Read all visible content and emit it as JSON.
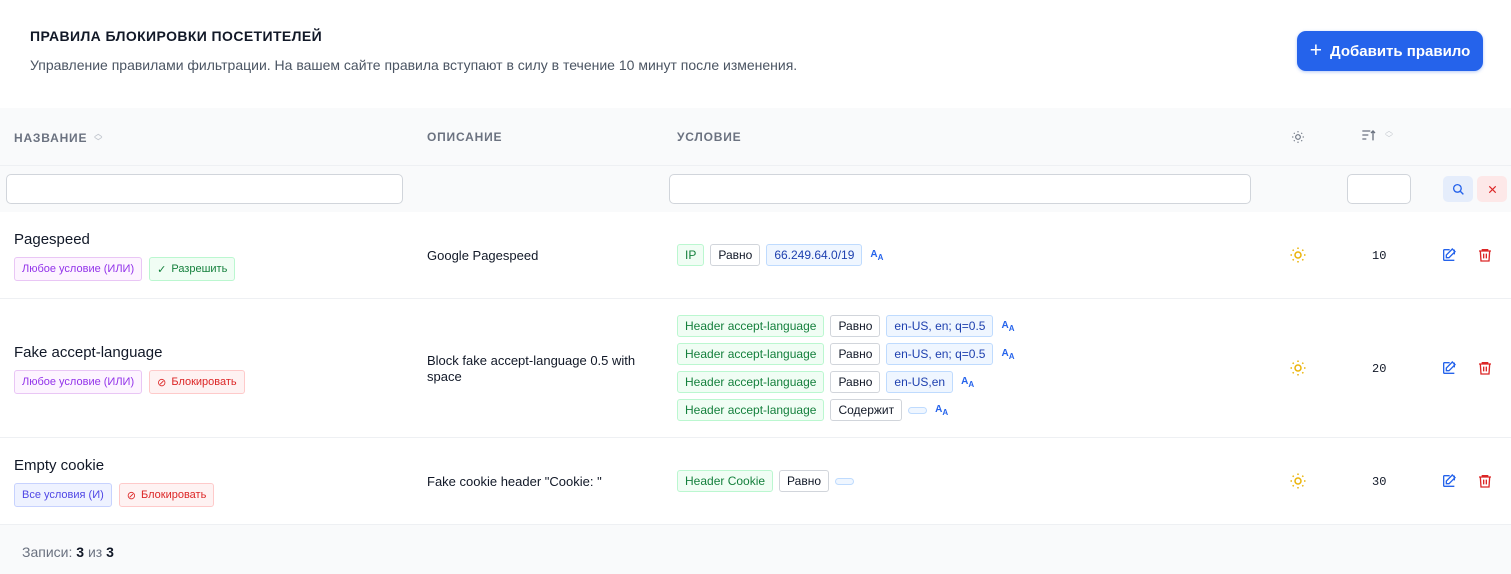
{
  "header": {
    "title": "ПРАВИЛА БЛОКИРОВКИ ПОСЕТИТЕЛЕЙ",
    "subtitle": "Управление правилами фильтрации. На вашем сайте правила вступают в силу в течение 10 минут после изменения.",
    "add_button_label": "Добавить правило",
    "accent_color": "#2563eb"
  },
  "table": {
    "columns": {
      "name": "НАЗВАНИЕ",
      "description": "ОПИСАНИЕ",
      "condition": "УСЛОВИЕ"
    },
    "icons": {
      "status_column": "sun-icon",
      "priority_column": "sort-priority-icon",
      "filter_search": "search-icon",
      "filter_clear": "close-icon",
      "edit": "edit-icon",
      "delete": "trash-icon",
      "case": "case-sensitive-icon"
    },
    "filters": {
      "name_value": "",
      "condition_value": "",
      "priority_value": ""
    },
    "rows": [
      {
        "name": "Pagespeed",
        "logic": "Любое условие (ИЛИ)",
        "action": "Разрешить",
        "description": "Google Pagespeed",
        "priority": "10",
        "conditions": [
          {
            "field": "IP",
            "op": "Равно",
            "value": "66.249.64.0/19"
          }
        ]
      },
      {
        "name": "Fake accept-language",
        "logic": "Любое условие (ИЛИ)",
        "action": "Блокировать",
        "description": "Block fake accept-language 0.5 with space",
        "priority": "20",
        "conditions": [
          {
            "field": "Header accept-language",
            "op": "Равно",
            "value": "en-US, en; q=0.5"
          },
          {
            "field": "Header accept-language",
            "op": "Равно",
            "value": "en-US, en; q=0.5"
          },
          {
            "field": "Header accept-language",
            "op": "Равно",
            "value": "en-US,en"
          },
          {
            "field": "Header accept-language",
            "op": "Содержит",
            "value": ""
          }
        ]
      },
      {
        "name": "Empty cookie",
        "logic": "Все условия (И)",
        "action": "Блокировать",
        "description": "Fake cookie header \"Cookie: \"",
        "priority": "30",
        "conditions": [
          {
            "field": "Header Cookie",
            "op": "Равно",
            "value": ""
          }
        ]
      }
    ]
  },
  "footer": {
    "label": "Записи:",
    "shown": "3",
    "of": "из",
    "total": "3"
  }
}
